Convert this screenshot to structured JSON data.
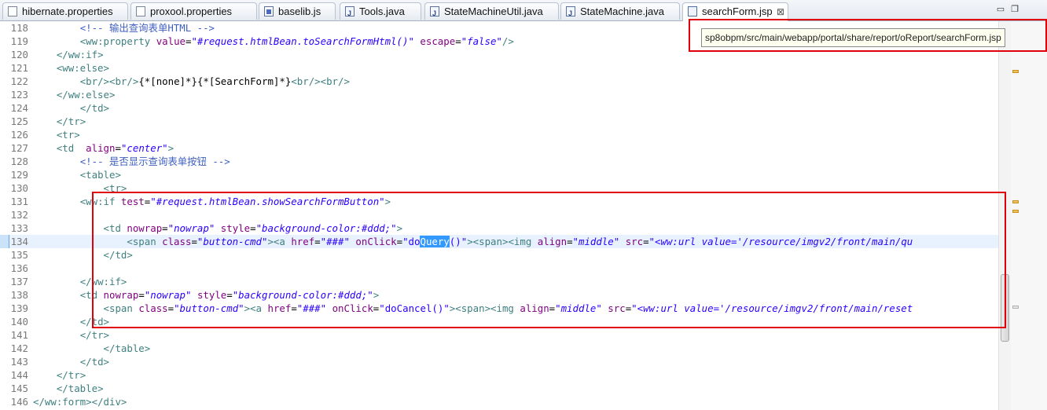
{
  "tabs": [
    {
      "label": "hibernate.properties",
      "icon": "properties-file-icon",
      "active": false
    },
    {
      "label": "proxool.properties",
      "icon": "properties-file-icon",
      "active": false
    },
    {
      "label": "baselib.js",
      "icon": "js-file-icon",
      "active": false
    },
    {
      "label": "Tools.java",
      "icon": "java-file-icon",
      "active": false
    },
    {
      "label": "StateMachineUtil.java",
      "icon": "java-file-icon",
      "active": false
    },
    {
      "label": "StateMachine.java",
      "icon": "java-file-icon",
      "active": false
    },
    {
      "label": "searchForm.jsp",
      "icon": "jsp-file-icon",
      "active": true,
      "close": "⊠"
    }
  ],
  "window_controls": [
    "minimize",
    "maximize"
  ],
  "tooltip": "sp8obpm/src/main/webapp/portal/share/report/oReport/searchForm.jsp",
  "lines": [
    {
      "n": "118",
      "text": "        <!-- 输出查询表单HTML -->"
    },
    {
      "n": "119",
      "text": "        <ww:property value=\"#request.htmlBean.toSearchFormHtml()\" escape=\"false\"/>"
    },
    {
      "n": "120",
      "text": "    </ww:if>"
    },
    {
      "n": "121",
      "text": "    <ww:else>"
    },
    {
      "n": "122",
      "text": "        <br/><br/>{*[none]*}{*[SearchForm]*}<br/><br/>"
    },
    {
      "n": "123",
      "text": "    </ww:else>"
    },
    {
      "n": "124",
      "text": "        </td>"
    },
    {
      "n": "125",
      "text": "    </tr>"
    },
    {
      "n": "126",
      "text": "    <tr>"
    },
    {
      "n": "127",
      "text": "    <td  align=\"center\">"
    },
    {
      "n": "128",
      "text": "        <!-- 是否显示查询表单按钮 -->"
    },
    {
      "n": "129",
      "text": "        <table>"
    },
    {
      "n": "130",
      "text": "            <tr>"
    },
    {
      "n": "131",
      "text": "        <ww:if test=\"#request.htmlBean.showSearchFormButton\">"
    },
    {
      "n": "132",
      "text": ""
    },
    {
      "n": "133",
      "text": "            <td nowrap=\"nowrap\" style=\"background-color:#ddd;\">"
    },
    {
      "n": "134",
      "text": "                <span class=\"button-cmd\"><a href=\"###\" onClick=\"doQuery()\"><span><img align=\"middle\" src=\"<ww:url value='/resource/imgv2/front/main/qu"
    },
    {
      "n": "135",
      "text": "            </td>"
    },
    {
      "n": "136",
      "text": ""
    },
    {
      "n": "137",
      "text": "        </ww:if>"
    },
    {
      "n": "138",
      "text": "        <td nowrap=\"nowrap\" style=\"background-color:#ddd;\">"
    },
    {
      "n": "139",
      "text": "            <span class=\"button-cmd\"><a href=\"###\" onClick=\"doCancel()\"><span><img align=\"middle\" src=\"<ww:url value='/resource/imgv2/front/main/reset"
    },
    {
      "n": "140",
      "text": "        </td>"
    },
    {
      "n": "141",
      "text": "        </tr>"
    },
    {
      "n": "142",
      "text": "            </table>"
    },
    {
      "n": "143",
      "text": "        </td>"
    },
    {
      "n": "144",
      "text": "    </tr>"
    },
    {
      "n": "145",
      "text": "    </table>"
    },
    {
      "n": "146",
      "text": "</ww:form></div>"
    }
  ],
  "current_line": "134",
  "selected_text": "Query",
  "colors": {
    "tag": "#3f7f7f",
    "attr": "#7f007f",
    "value": "#2a00ff",
    "comment": "#3f5fbf",
    "highlight_box": "#e0000a",
    "selection": "#3399ff"
  }
}
